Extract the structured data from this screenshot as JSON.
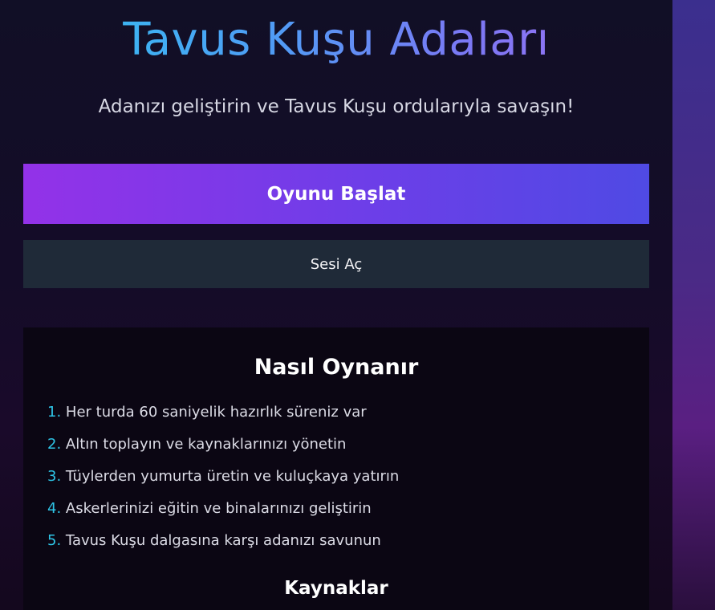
{
  "game": {
    "title": "Tavus Kuşu Adaları",
    "subtitle": "Adanızı geliştirin ve Tavus Kuşu ordularıyla savaşın!"
  },
  "buttons": {
    "start_label": "Oyunu Başlat",
    "sound_label": "Sesi Aç"
  },
  "how_to_play": {
    "title": "Nasıl Oynanır",
    "steps": [
      {
        "num": "1.",
        "text": "Her turda 60 saniyelik hazırlık süreniz var"
      },
      {
        "num": "2.",
        "text": "Altın toplayın ve kaynaklarınızı yönetin"
      },
      {
        "num": "3.",
        "text": "Tüylerden yumurta üretin ve kuluçkaya yatırın"
      },
      {
        "num": "4.",
        "text": "Askerlerinizi eğitin ve binalarınızı geliştirin"
      },
      {
        "num": "5.",
        "text": "Tavus Kuşu dalgasına karşı adanızı savunun"
      }
    ]
  },
  "resources": {
    "title": "Kaynaklar"
  },
  "colors": {
    "accent_cyan": "#2ec4e6",
    "accent_purple": "#9332e8",
    "accent_indigo": "#4f4ae4",
    "button_dark": "#1f2a38"
  }
}
